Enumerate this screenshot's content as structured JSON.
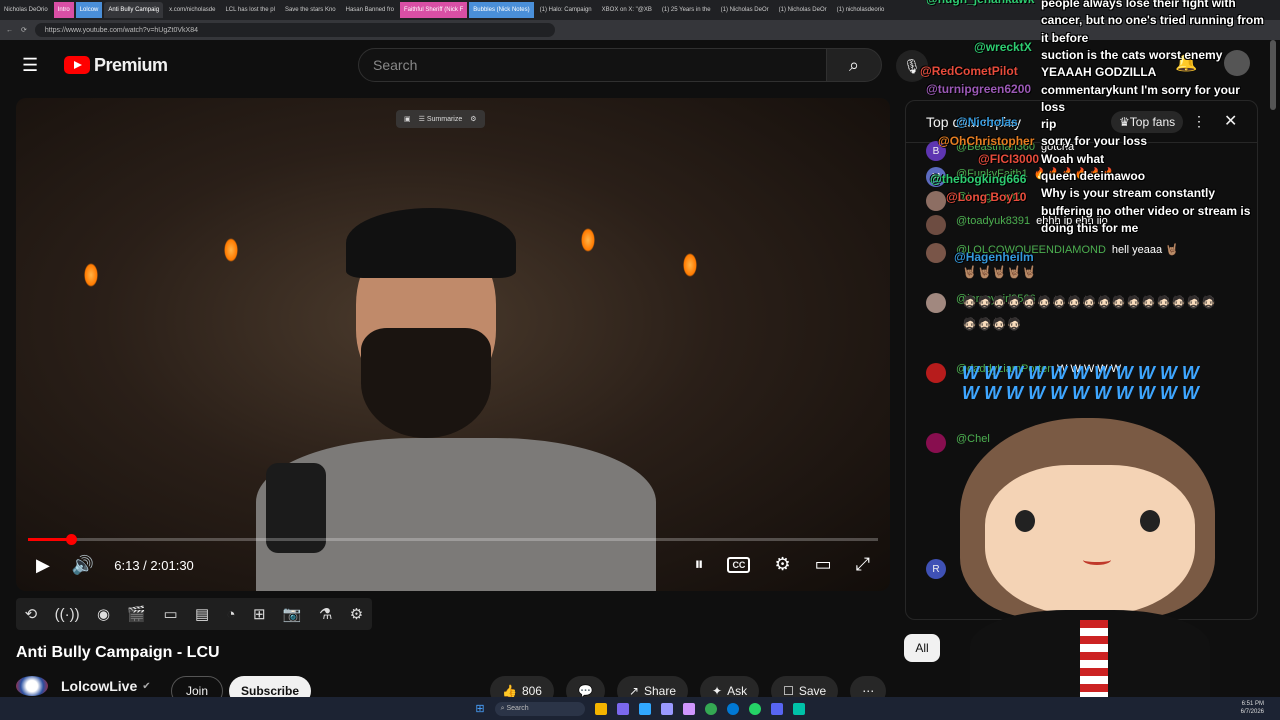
{
  "browser": {
    "tabs": [
      {
        "label": "Nicholas DeOrio",
        "style": "normal"
      },
      {
        "label": "Intro",
        "style": "pink"
      },
      {
        "label": "Lolcow",
        "style": "blue"
      },
      {
        "label": "Anti Bully Campaig",
        "style": "active"
      },
      {
        "label": "x.com/nicholasde",
        "style": "normal"
      },
      {
        "label": "LCL has lost the pl",
        "style": "normal"
      },
      {
        "label": "Save the stars Kno",
        "style": "normal"
      },
      {
        "label": "Hasan Banned fro",
        "style": "normal"
      },
      {
        "label": "Faithful Sheriff (Nick F",
        "style": "pink"
      },
      {
        "label": "Bubbles (Nick Notes)",
        "style": "blue"
      },
      {
        "label": "(1) Halo: Campaign",
        "style": "normal"
      },
      {
        "label": "XBOX on X: \"@XB",
        "style": "normal"
      },
      {
        "label": "(1) 25 Years in the",
        "style": "normal"
      },
      {
        "label": "(1) Nicholas DeOr",
        "style": "normal"
      },
      {
        "label": "(1) Nicholas DeOr",
        "style": "normal"
      },
      {
        "label": "(1) nicholasdeorio",
        "style": "normal"
      }
    ],
    "url": "https://www.youtube.com/watch?v=hUgZt0VkX84"
  },
  "header": {
    "logo_text": "Premium",
    "search_placeholder": "Search"
  },
  "player": {
    "summarize_label": "Summarize",
    "current_time": "6:13",
    "duration": "2:01:30",
    "timecode": "6:13 / 2:01:30",
    "progress_fraction": 0.051
  },
  "video": {
    "title": "Anti Bully Campaign - LCU",
    "channel": "LolcowLive",
    "join_label": "Join",
    "subscribe_label": "Subscribe",
    "likes": "806",
    "share_label": "Share",
    "ask_label": "Ask",
    "save_label": "Save"
  },
  "chat": {
    "header_title": "Top chat replay",
    "top_fans_label": "Top fans",
    "filter_chip": "All",
    "messages": [
      {
        "author": "@Beastman360",
        "text": "gotcha",
        "avatar_letter": "B",
        "avatar_color": "#5e35b1"
      },
      {
        "author": "@FunkyFaith1",
        "text": "🔥🔥🔥🔥🔥🔥",
        "avatar_letter": "M",
        "avatar_color": "#5c6bc0"
      },
      {
        "author": "@LongBoy10",
        "text": "",
        "avatar_letter": "",
        "avatar_color": "#8d6e63"
      },
      {
        "author": "@toadyuk8391",
        "text": "ehhh ip ehh iio",
        "avatar_letter": "",
        "avatar_color": "#6d4c41"
      },
      {
        "author": "@LOLCOWQUEENDIAMOND",
        "text": "hell yeaaa 🤘🏽",
        "avatar_letter": "",
        "avatar_color": "#795548"
      },
      {
        "author": "@jerseygirl3566",
        "text": "",
        "avatar_letter": "",
        "avatar_color": "#a1887f"
      },
      {
        "author": "@daddyLiamPorter",
        "text": "W W W W W",
        "avatar_letter": "",
        "avatar_color": "#b71c1c"
      },
      {
        "author": "@Chel",
        "text": "",
        "avatar_letter": "",
        "avatar_color": "#880e4f"
      }
    ],
    "emote_row_horns": "🤘🏽🤘🏽🤘🏽🤘🏽🤘🏽",
    "emote_row_faces": "🧔🏻🧔🏻🧔🏻🧔🏻🧔🏻🧔🏻🧔🏻🧔🏻🧔🏻🧔🏻🧔🏻🧔🏻🧔🏻🧔🏻🧔🏻🧔🏻🧔🏻🧔🏻🧔🏻🧔🏻🧔🏻",
    "w_spam": "W W W W W W W W W W W W W W W W W W W W W W",
    "bottom_avatar_letter": "R"
  },
  "overlay": {
    "names": [
      {
        "text": "@hugh_jehankawk",
        "color": "#2ecc71"
      },
      {
        "text": "@wrecktX",
        "color": "#2ecc71"
      },
      {
        "text": "@RedCometPilot",
        "color": "#e74c3c"
      },
      {
        "text": "@turnipgreen6200",
        "color": "#9b59b6"
      },
      {
        "text": "@Nicholas",
        "color": "#3498db"
      },
      {
        "text": "@OhChristopher",
        "color": "#e67e22"
      },
      {
        "text": "@FICI3000",
        "color": "#e74c3c"
      },
      {
        "text": "@thebogking666",
        "color": "#2ecc71"
      },
      {
        "text": "@Long Boy10",
        "color": "#e74c3c"
      },
      {
        "text": "@Hagenheilm",
        "color": "#3498db"
      }
    ],
    "lines": [
      "people always lose their fight with",
      "cancer, but no one's tried running from",
      "it before",
      "suction is the cats worst enemy",
      "YEAAAH GODZILLA",
      "commentarykunt I'm sorry for your",
      "loss",
      "rip",
      "sorry for your loss",
      "Woah what",
      "queen deeimawoo",
      "Why is your stream constantly",
      "buffering no other video or stream is",
      "doing this for me"
    ]
  },
  "taskbar": {
    "search_label": "Search",
    "time": "6:51 PM",
    "date": "6/7/2026"
  },
  "colors": {
    "accent": "#ff0000",
    "chat_author": "#4caf50",
    "w_spam": "#3ea6ff"
  }
}
